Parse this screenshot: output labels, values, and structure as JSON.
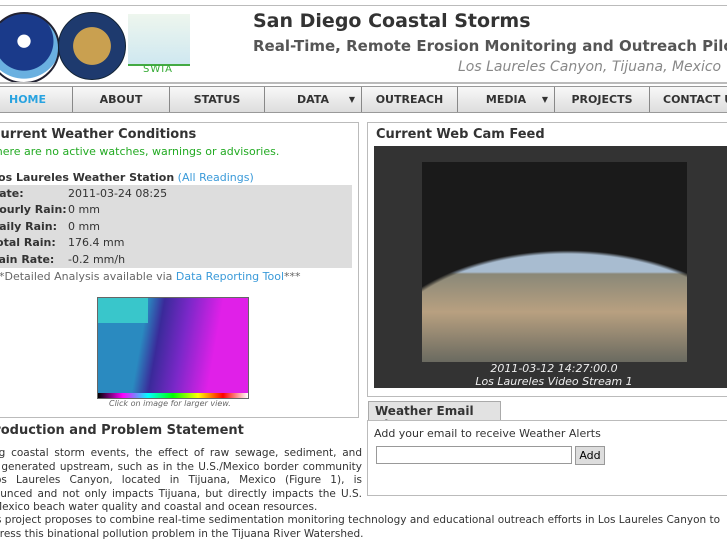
{
  "header": {
    "title": "San Diego Coastal Storms",
    "subtitle": "Real-Time, Remote Erosion Monitoring and Outreach Pilot",
    "location": "Los Laureles Canyon, Tijuana, Mexico",
    "logos": [
      "NOAA",
      "California State Parks",
      "SWIA"
    ]
  },
  "nav": [
    {
      "label": "HOME",
      "active": true
    },
    {
      "label": "ABOUT"
    },
    {
      "label": "STATUS"
    },
    {
      "label": "DATA",
      "dropdown": true
    },
    {
      "label": "OUTREACH"
    },
    {
      "label": "MEDIA",
      "dropdown": true
    },
    {
      "label": "PROJECTS"
    },
    {
      "label": "CONTACT US"
    }
  ],
  "weather": {
    "title": "Current Weather Conditions",
    "advisory": "There are no active watches, warnings or advisories.",
    "station": "Los Laureles Weather Station",
    "all_readings": "(All Readings)",
    "readings": [
      {
        "k": "Date:",
        "v": "2011-03-24 08:25"
      },
      {
        "k": "Hourly Rain:",
        "v": "0 mm"
      },
      {
        "k": "Daily Rain:",
        "v": "0 mm"
      },
      {
        "k": "Total Rain:",
        "v": "176.4 mm"
      },
      {
        "k": "Rain Rate:",
        "v": "-0.2 mm/h"
      }
    ],
    "note_pre": "***Detailed Analysis available via ",
    "note_link": "Data Reporting Tool",
    "note_post": "***",
    "caption": "Click on image for larger view."
  },
  "webcam": {
    "title": "Current Web Cam Feed",
    "timestamp": "2011-03-12 14:27:00.0",
    "stream": "Los Laureles Video Stream 1"
  },
  "alerts": {
    "tab": "Weather Email Alerts",
    "prompt": "Add your email to receive Weather Alerts",
    "email_value": "",
    "add": "Add"
  },
  "intro": {
    "title": "Introduction and Problem Statement",
    "p1": "During coastal storm events, the effect of raw sewage, sediment, and trash generated upstream, such as in the U.S./Mexico border community of Los Laureles Canyon, located in Tijuana, Mexico (Figure 1), is pronounced and not only impacts Tijuana, but directly impacts the U.S. and Mexico beach water quality and coastal and ocean resources.",
    "p2": "This project proposes to combine real-time sedimentation monitoring technology and educational outreach efforts in Los Laureles Canyon to address this binational pollution problem in the Tijuana River Watershed."
  }
}
